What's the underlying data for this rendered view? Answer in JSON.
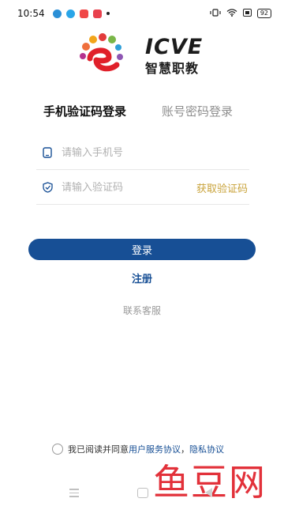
{
  "status_bar": {
    "time": "10:54",
    "battery": "92"
  },
  "brand": {
    "name": "ICVE",
    "subtitle": "智慧职教"
  },
  "tabs": [
    {
      "label": "手机验证码登录",
      "active": true
    },
    {
      "label": "账号密码登录",
      "active": false
    }
  ],
  "form": {
    "phone_placeholder": "请输入手机号",
    "code_placeholder": "请输入验证码",
    "get_code_label": "获取验证码"
  },
  "actions": {
    "login_label": "登录",
    "register_label": "注册",
    "contact_label": "联系客服"
  },
  "agreement": {
    "prefix": "我已阅读并同意",
    "terms_label": "用户服务协议",
    "separator": "，",
    "privacy_label": "隐私协议"
  },
  "watermark": {
    "text": "鱼豆网"
  },
  "colors": {
    "primary": "#174f95",
    "accent": "#c9a33b"
  },
  "icons": [
    "wifi-icon",
    "battery-icon",
    "phone-icon",
    "shield-icon",
    "menu-icon",
    "home-icon",
    "back-icon"
  ]
}
